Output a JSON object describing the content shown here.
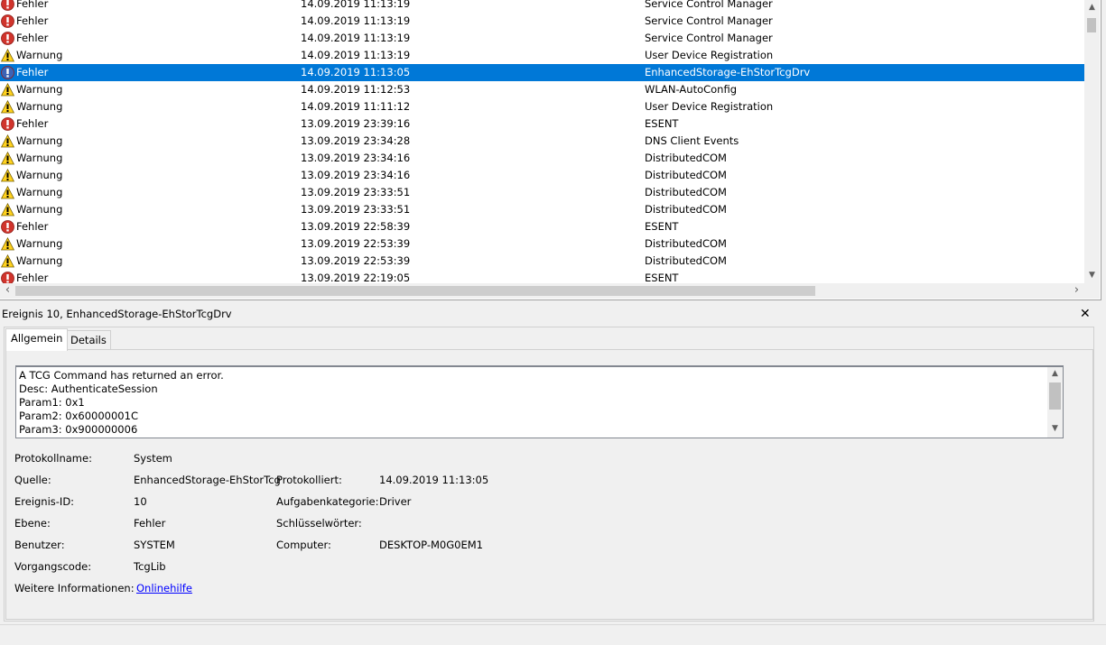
{
  "events": [
    {
      "level": "Fehler",
      "level_icon": "error-icon",
      "datetime": "14.09.2019 11:13:19",
      "source": "Service Control Manager"
    },
    {
      "level": "Fehler",
      "level_icon": "error-icon",
      "datetime": "14.09.2019 11:13:19",
      "source": "Service Control Manager"
    },
    {
      "level": "Fehler",
      "level_icon": "error-icon",
      "datetime": "14.09.2019 11:13:19",
      "source": "Service Control Manager"
    },
    {
      "level": "Warnung",
      "level_icon": "warning-icon",
      "datetime": "14.09.2019 11:13:19",
      "source": "User Device Registration"
    },
    {
      "level": "Fehler",
      "level_icon": "error-icon",
      "datetime": "14.09.2019 11:13:05",
      "source": "EnhancedStorage-EhStorTcgDrv",
      "selected": true
    },
    {
      "level": "Warnung",
      "level_icon": "warning-icon",
      "datetime": "14.09.2019 11:12:53",
      "source": "WLAN-AutoConfig"
    },
    {
      "level": "Warnung",
      "level_icon": "warning-icon",
      "datetime": "14.09.2019 11:11:12",
      "source": "User Device Registration"
    },
    {
      "level": "Fehler",
      "level_icon": "error-icon",
      "datetime": "13.09.2019 23:39:16",
      "source": "ESENT"
    },
    {
      "level": "Warnung",
      "level_icon": "warning-icon",
      "datetime": "13.09.2019 23:34:28",
      "source": "DNS Client Events"
    },
    {
      "level": "Warnung",
      "level_icon": "warning-icon",
      "datetime": "13.09.2019 23:34:16",
      "source": "DistributedCOM"
    },
    {
      "level": "Warnung",
      "level_icon": "warning-icon",
      "datetime": "13.09.2019 23:34:16",
      "source": "DistributedCOM"
    },
    {
      "level": "Warnung",
      "level_icon": "warning-icon",
      "datetime": "13.09.2019 23:33:51",
      "source": "DistributedCOM"
    },
    {
      "level": "Warnung",
      "level_icon": "warning-icon",
      "datetime": "13.09.2019 23:33:51",
      "source": "DistributedCOM"
    },
    {
      "level": "Fehler",
      "level_icon": "error-icon",
      "datetime": "13.09.2019 22:58:39",
      "source": "ESENT"
    },
    {
      "level": "Warnung",
      "level_icon": "warning-icon",
      "datetime": "13.09.2019 22:53:39",
      "source": "DistributedCOM"
    },
    {
      "level": "Warnung",
      "level_icon": "warning-icon",
      "datetime": "13.09.2019 22:53:39",
      "source": "DistributedCOM"
    },
    {
      "level": "Fehler",
      "level_icon": "error-icon",
      "datetime": "13.09.2019 22:19:05",
      "source": "ESENT"
    }
  ],
  "colors": {
    "selection": "#0078d7",
    "error": "#d0342c",
    "warning": "#ffd21f",
    "link": "#0000ff"
  },
  "detail": {
    "title": "Ereignis 10, EnhancedStorage-EhStorTcgDrv",
    "close_glyph": "✕",
    "tabs": {
      "general": "Allgemein",
      "details": "Details"
    },
    "message_lines": [
      "A TCG Command has returned an error.",
      "Desc: AuthenticateSession",
      "Param1: 0x1",
      "Param2: 0x60000001C",
      "Param3: 0x900000006"
    ],
    "fields": {
      "log_name": {
        "label": "Protokollname:",
        "value": "System"
      },
      "source": {
        "label": "Quelle:",
        "value": "EnhancedStorage-EhStorTcg"
      },
      "logged": {
        "label": "Protokolliert:",
        "value": "14.09.2019 11:13:05"
      },
      "event_id": {
        "label": "Ereignis-ID:",
        "value": "10"
      },
      "task_category": {
        "label": "Aufgabenkategorie:",
        "value": "Driver"
      },
      "level": {
        "label": "Ebene:",
        "value": "Fehler"
      },
      "keywords": {
        "label": "Schlüsselwörter:",
        "value": ""
      },
      "user": {
        "label": "Benutzer:",
        "value": "SYSTEM"
      },
      "computer": {
        "label": "Computer:",
        "value": "DESKTOP-M0G0EM1"
      },
      "opcode": {
        "label": "Vorgangscode:",
        "value": "TcgLib"
      },
      "more_info": {
        "label": "Weitere Informationen:",
        "value": "Onlinehilfe"
      }
    }
  }
}
